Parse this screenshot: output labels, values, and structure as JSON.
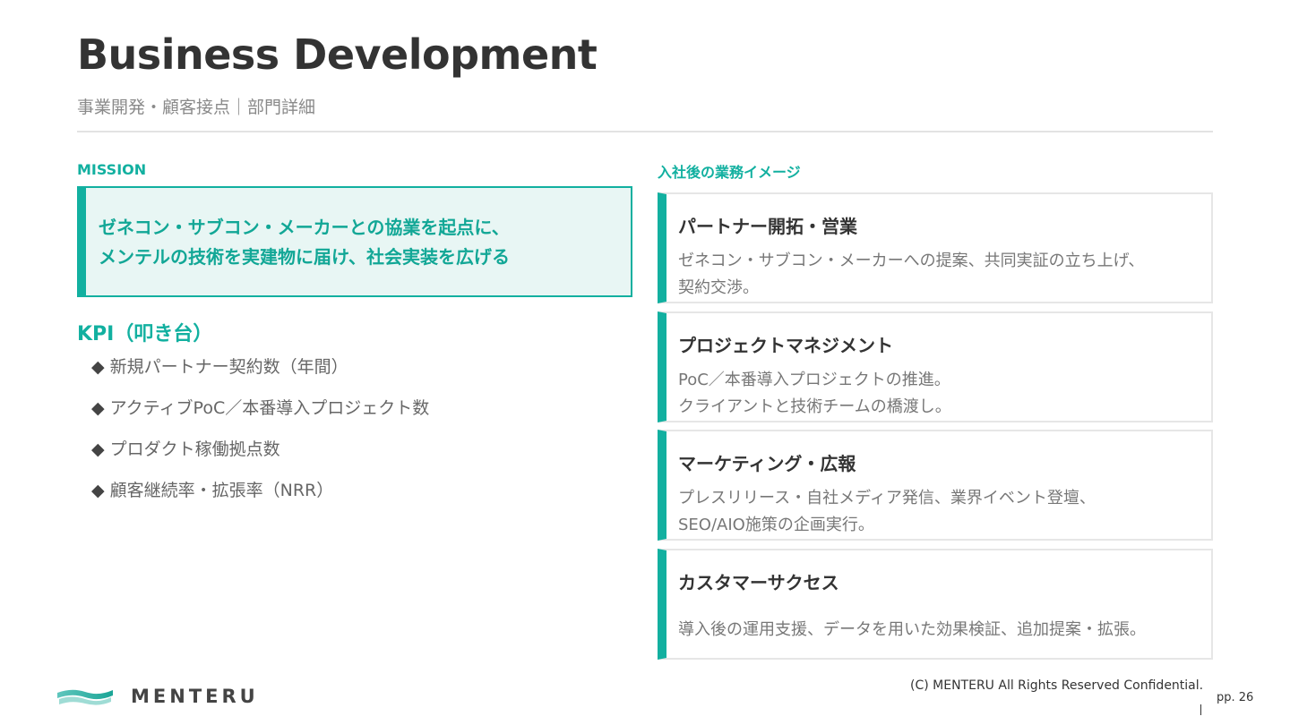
{
  "header": {
    "title": "Business Development",
    "subtitle": "事業開発・顧客接点｜部門詳細"
  },
  "mission": {
    "label": "MISSION",
    "lines": [
      "ゼネコン・サブコン・メーカーとの協業を起点に、",
      "メンテルの技術を実建物に届け、社会実装を広げる"
    ]
  },
  "kpi": {
    "title": "KPI（叩き台）",
    "bullet": "◆",
    "items": [
      "新規パートナー契約数（年間）",
      "アクティブPoC／本番導入プロジェクト数",
      "プロダクト稼働拠点数",
      "顧客継続率・拡張率（NRR）"
    ]
  },
  "work": {
    "label": "入社後の業務イメージ",
    "cards": [
      {
        "title": "パートナー開拓・営業",
        "desc": [
          "ゼネコン・サブコン・メーカーへの提案、共同実証の立ち上げ、",
          "契約交渉。"
        ]
      },
      {
        "title": "プロジェクトマネジメント",
        "desc": [
          "PoC／本番導入プロジェクトの推進。",
          "クライアントと技術チームの橋渡し。"
        ]
      },
      {
        "title": "マーケティング・広報",
        "desc": [
          "プレスリリース・自社メディア発信、業界イベント登壇、",
          "SEO/AIO施策の企画実行。"
        ]
      },
      {
        "title": "カスタマーサクセス",
        "desc": [
          "導入後の運用支援、データを用いた効果検証、追加提案・拡張。"
        ]
      }
    ]
  },
  "footer": {
    "logo_text": "MENTERU",
    "copyright": "(C) MENTERU All Rights Reserved Confidential.",
    "page": "pp. 26"
  },
  "colors": {
    "accent": "#12b0a0",
    "mission_bg": "#e8f6f4",
    "title": "#333333",
    "muted": "#8a8a8a"
  }
}
